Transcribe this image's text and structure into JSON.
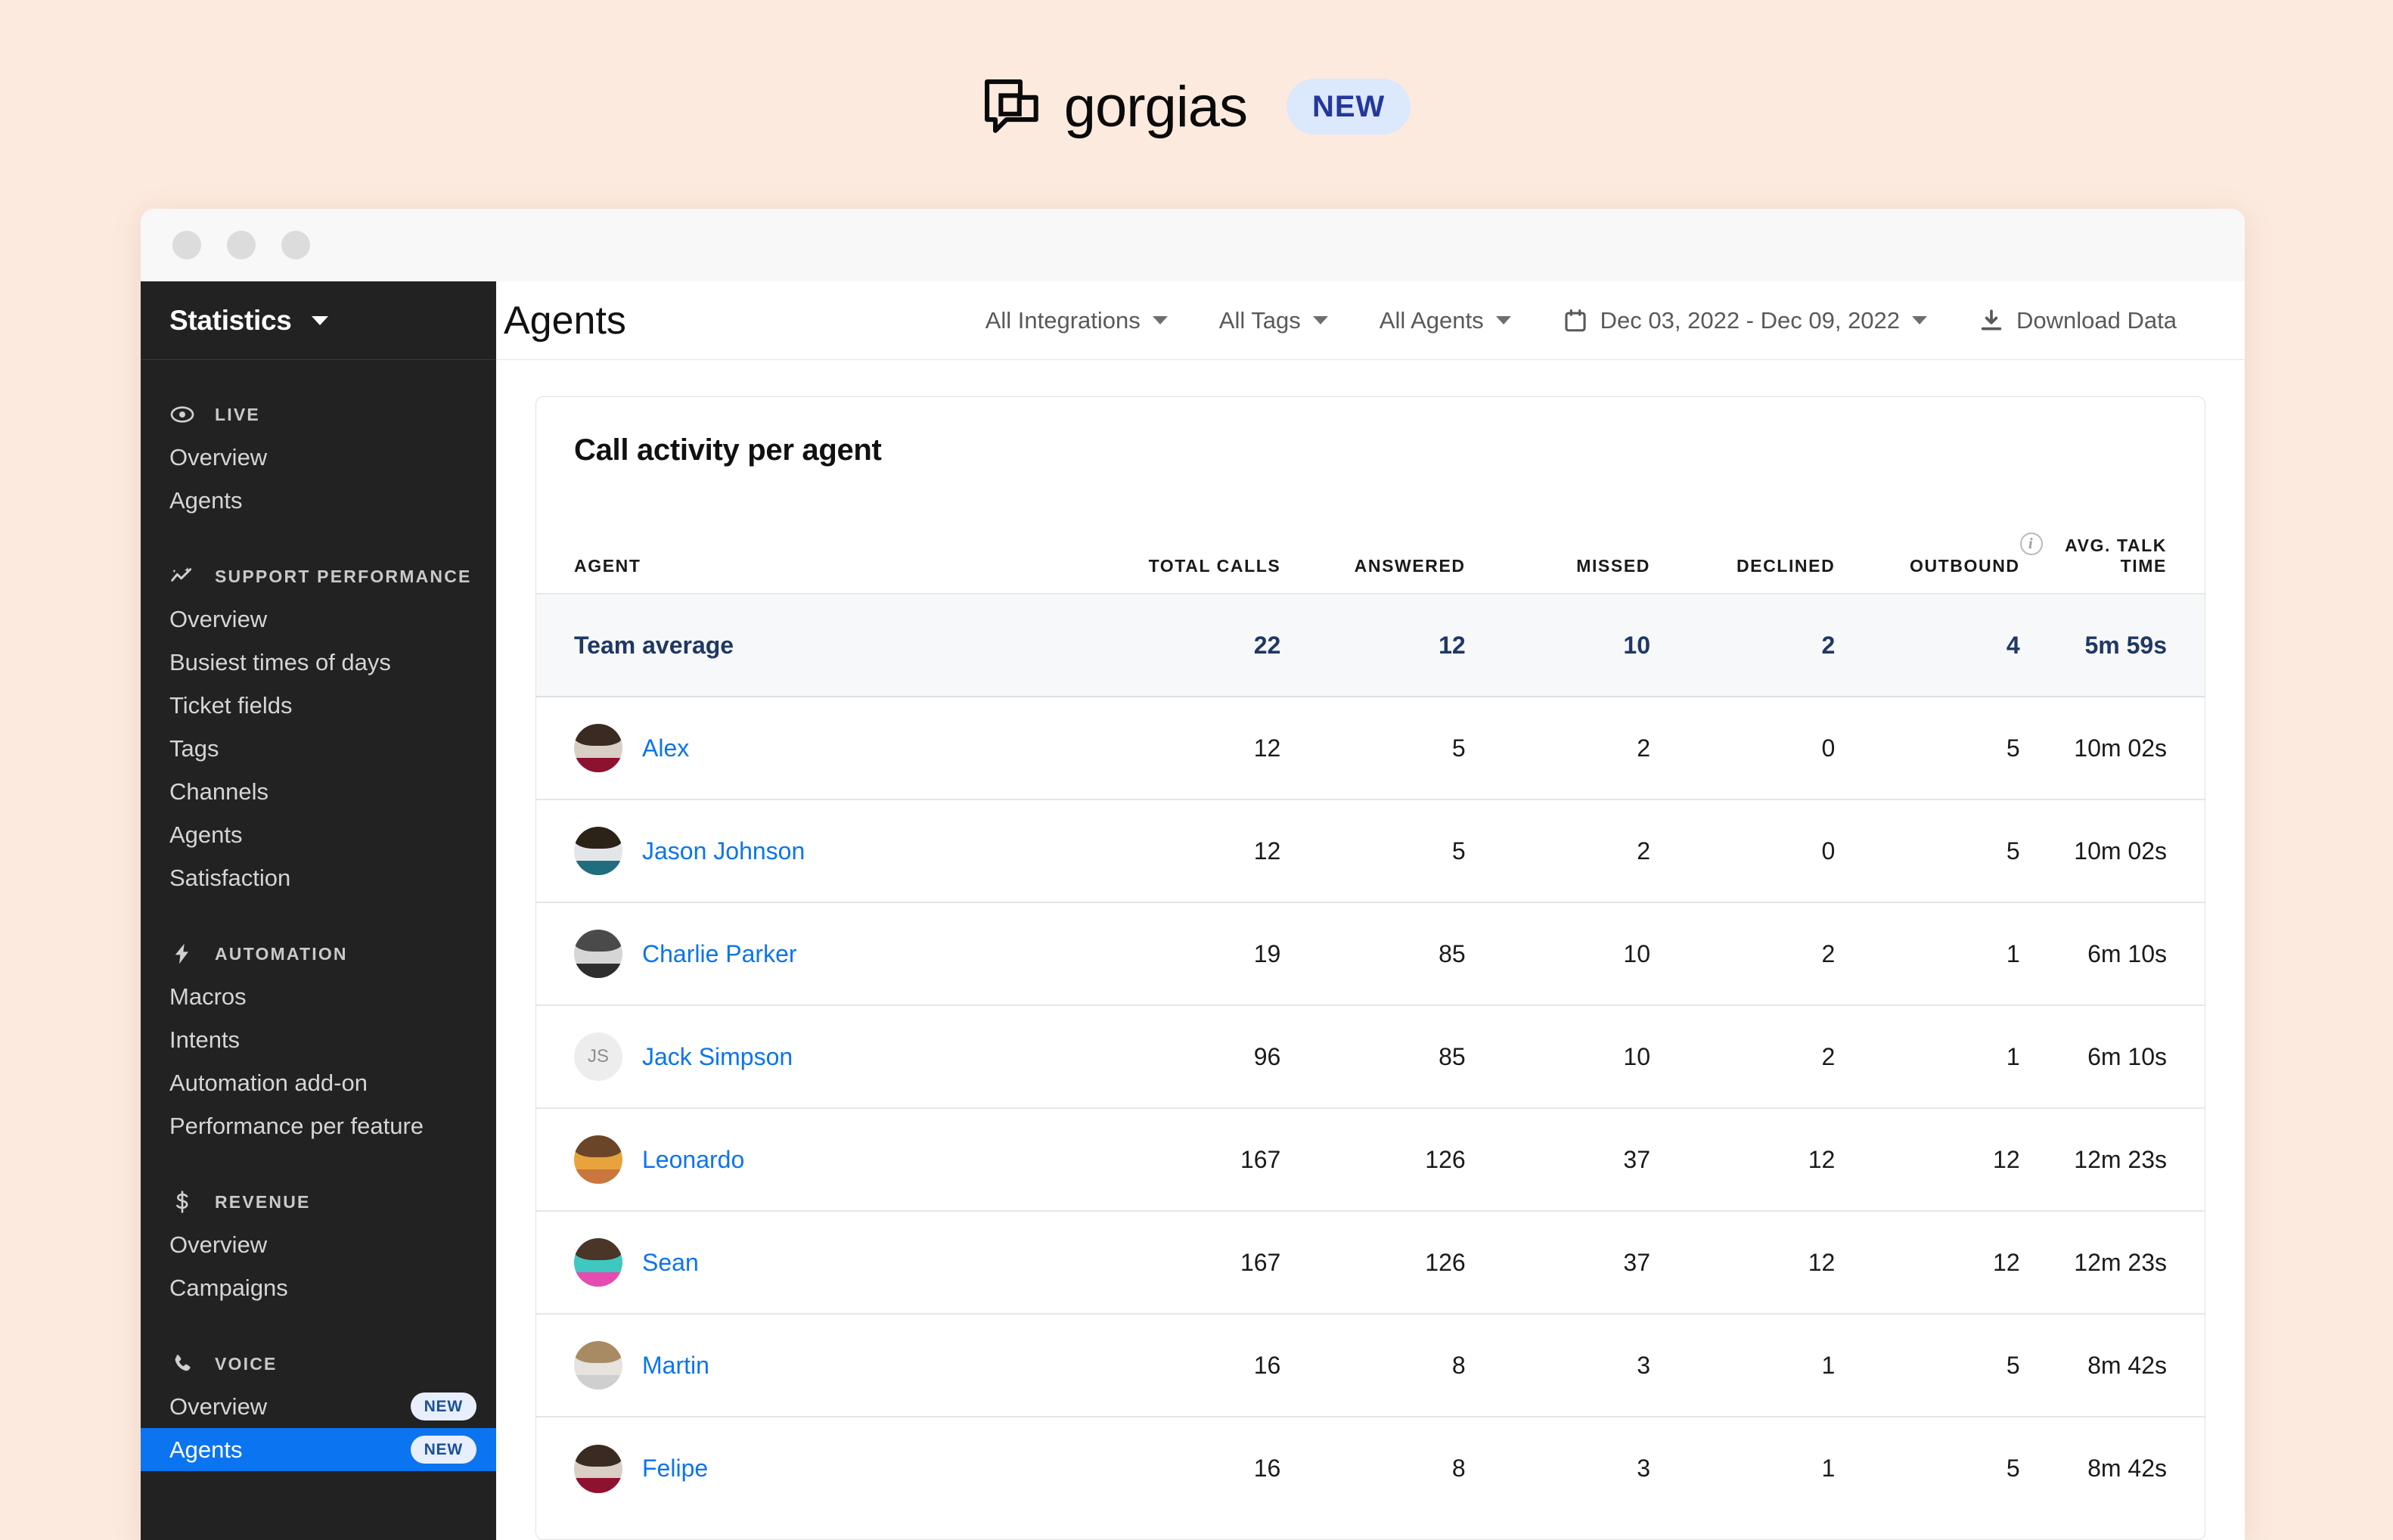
{
  "brand": {
    "name": "gorgias",
    "badge": "NEW",
    "logo_icon": "gorgias-logo-icon"
  },
  "window": {
    "traffic_lights": [
      "close-dot",
      "minimize-dot",
      "maximize-dot"
    ]
  },
  "sidebar": {
    "title": "Statistics",
    "title_caret_icon": "chevron-down-icon",
    "sections": [
      {
        "label": "LIVE",
        "icon": "live-dot-icon",
        "items": [
          {
            "label": "Overview",
            "badge": null,
            "active": false
          },
          {
            "label": "Agents",
            "badge": null,
            "active": false
          }
        ]
      },
      {
        "label": "SUPPORT PERFORMANCE",
        "icon": "trend-sparkle-icon",
        "items": [
          {
            "label": "Overview",
            "badge": null,
            "active": false
          },
          {
            "label": "Busiest times of days",
            "badge": null,
            "active": false
          },
          {
            "label": "Ticket fields",
            "badge": null,
            "active": false
          },
          {
            "label": "Tags",
            "badge": null,
            "active": false
          },
          {
            "label": "Channels",
            "badge": null,
            "active": false
          },
          {
            "label": "Agents",
            "badge": null,
            "active": false
          },
          {
            "label": "Satisfaction",
            "badge": null,
            "active": false
          }
        ]
      },
      {
        "label": "AUTOMATION",
        "icon": "lightning-bolt-icon",
        "items": [
          {
            "label": "Macros",
            "badge": null,
            "active": false
          },
          {
            "label": "Intents",
            "badge": null,
            "active": false
          },
          {
            "label": "Automation add-on",
            "badge": null,
            "active": false
          },
          {
            "label": "Performance per feature",
            "badge": null,
            "active": false
          }
        ]
      },
      {
        "label": "REVENUE",
        "icon": "dollar-sign-icon",
        "items": [
          {
            "label": "Overview",
            "badge": null,
            "active": false
          },
          {
            "label": "Campaigns",
            "badge": null,
            "active": false
          }
        ]
      },
      {
        "label": "VOICE",
        "icon": "phone-icon",
        "items": [
          {
            "label": "Overview",
            "badge": "NEW",
            "active": false
          },
          {
            "label": "Agents",
            "badge": "NEW",
            "active": true
          }
        ]
      }
    ]
  },
  "topbar": {
    "page_title": "Agents",
    "filters": [
      {
        "label": "All Integrations",
        "icon": null,
        "caret_icon": "chevron-down-icon"
      },
      {
        "label": "All Tags",
        "icon": null,
        "caret_icon": "chevron-down-icon"
      },
      {
        "label": "All Agents",
        "icon": null,
        "caret_icon": "chevron-down-icon"
      },
      {
        "label": "Dec 03, 2022 - Dec 09, 2022",
        "icon": "calendar-icon",
        "caret_icon": "chevron-down-icon"
      },
      {
        "label": "Download Data",
        "icon": "download-icon",
        "caret_icon": null
      }
    ]
  },
  "card": {
    "title": "Call activity per agent",
    "info_icon": "info-icon",
    "columns": [
      "AGENT",
      "TOTAL CALLS",
      "ANSWERED",
      "MISSED",
      "DECLINED",
      "OUTBOUND",
      "AVG. TALK TIME"
    ],
    "team_average": {
      "label": "Team average",
      "total_calls": "22",
      "answered": "12",
      "missed": "10",
      "declined": "2",
      "outbound": "4",
      "avg_talk_time": "5m 59s"
    },
    "rows": [
      {
        "name": "Alex",
        "avatar_type": "photo",
        "avatar_colors": {
          "bg": "#d9cfc6",
          "hair": "#3a2b22",
          "body": "#8e1130"
        },
        "initials": "",
        "total_calls": "12",
        "answered": "5",
        "missed": "2",
        "declined": "0",
        "outbound": "5",
        "avg_talk_time": "10m 02s"
      },
      {
        "name": "Jason Johnson",
        "avatar_type": "photo",
        "avatar_colors": {
          "bg": "#e3e6e8",
          "hair": "#2b2218",
          "body": "#1f6d7d"
        },
        "initials": "",
        "total_calls": "12",
        "answered": "5",
        "missed": "2",
        "declined": "0",
        "outbound": "5",
        "avg_talk_time": "10m 02s"
      },
      {
        "name": "Charlie Parker",
        "avatar_type": "photo",
        "avatar_colors": {
          "bg": "#d6d6d6",
          "hair": "#4a4a4a",
          "body": "#2e2e2e"
        },
        "initials": "",
        "total_calls": "19",
        "answered": "85",
        "missed": "10",
        "declined": "2",
        "outbound": "1",
        "avg_talk_time": "6m 10s"
      },
      {
        "name": "Jack Simpson",
        "avatar_type": "initials",
        "avatar_colors": {
          "bg": "#ededed",
          "hair": "#ededed",
          "body": "#ededed"
        },
        "initials": "JS",
        "total_calls": "96",
        "answered": "85",
        "missed": "10",
        "declined": "2",
        "outbound": "1",
        "avg_talk_time": "6m 10s"
      },
      {
        "name": "Leonardo",
        "avatar_type": "photo",
        "avatar_colors": {
          "bg": "#e8a33c",
          "hair": "#6b4528",
          "body": "#c9763f"
        },
        "initials": "",
        "total_calls": "167",
        "answered": "126",
        "missed": "37",
        "declined": "12",
        "outbound": "12",
        "avg_talk_time": "12m 23s"
      },
      {
        "name": "Sean",
        "avatar_type": "photo",
        "avatar_colors": {
          "bg": "#3ec8c0",
          "hair": "#4a3526",
          "body": "#e54bb0"
        },
        "initials": "",
        "total_calls": "167",
        "answered": "126",
        "missed": "37",
        "declined": "12",
        "outbound": "12",
        "avg_talk_time": "12m 23s"
      },
      {
        "name": "Martin",
        "avatar_type": "photo",
        "avatar_colors": {
          "bg": "#e6e2dd",
          "hair": "#a98b63",
          "body": "#cfcfcf"
        },
        "initials": "",
        "total_calls": "16",
        "answered": "8",
        "missed": "3",
        "declined": "1",
        "outbound": "5",
        "avg_talk_time": "8m 42s"
      },
      {
        "name": "Felipe",
        "avatar_type": "photo",
        "avatar_colors": {
          "bg": "#d9cfc6",
          "hair": "#3a2b22",
          "body": "#8e1130"
        },
        "initials": "",
        "total_calls": "16",
        "answered": "8",
        "missed": "3",
        "declined": "1",
        "outbound": "5",
        "avg_talk_time": "8m 42s"
      }
    ]
  }
}
